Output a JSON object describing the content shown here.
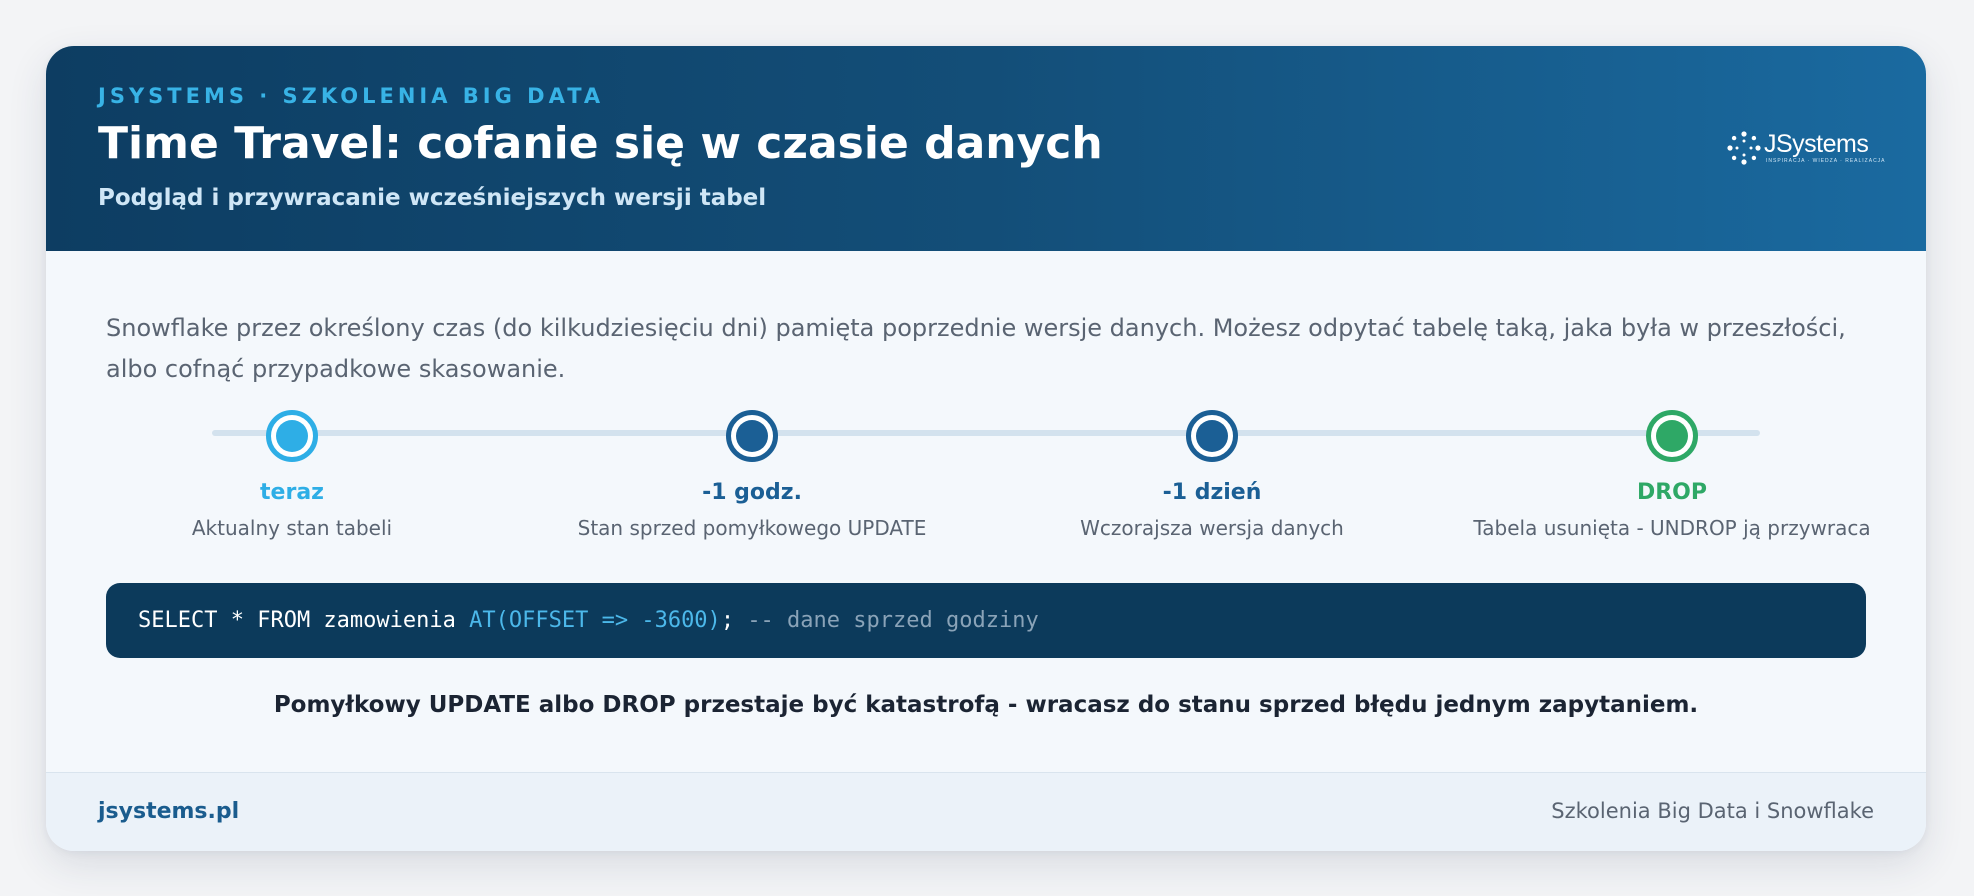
{
  "header": {
    "eyebrow": "JSYSTEMS · SZKOLENIA BIG DATA",
    "title": "Time Travel: cofanie się w czasie danych",
    "subtitle": "Podgląd i przywracanie wcześniejszych wersji tabel",
    "logo": {
      "name": "JSystems",
      "tagline": "INSPIRACJA · WIEDZA · REALIZACJA",
      "icon": "dot-circle-logo-icon"
    }
  },
  "intro": "Snowflake przez określony czas (do kilkudziesięciu dni) pamięta poprzednie wersje danych. Możesz odpytać tabelę taką, jaka była w przeszłości, albo cofnąć przypadkowe skasowanie.",
  "timeline": {
    "points": [
      {
        "label": "teraz",
        "desc": "Aktualny stan tabeli",
        "color": "#2eaee6",
        "ring": "#2eaee6"
      },
      {
        "label": "-1 godz.",
        "desc": "Stan sprzed pomyłkowego UPDATE",
        "color": "#1b5f95",
        "ring": "#1b5f95"
      },
      {
        "label": "-1 dzień",
        "desc": "Wczorajsza wersja danych",
        "color": "#1b5f95",
        "ring": "#1b5f95"
      },
      {
        "label": "DROP",
        "desc": "Tabela usunięta - UNDROP ją przywraca",
        "color": "#2ea866",
        "ring": "#2ea866"
      }
    ]
  },
  "code": {
    "base": "SELECT * FROM zamowienia ",
    "keyword": "AT(OFFSET => -3600)",
    "semicolon": "; ",
    "comment": "-- dane sprzed godziny"
  },
  "tagline": "Pomyłkowy UPDATE albo DROP przestaje być katastrofą - wracasz do stanu sprzed błędu jednym zapytaniem.",
  "footer": {
    "left": "jsystems.pl",
    "right": "Szkolenia Big Data i Snowflake"
  },
  "colors": {
    "header_dark": "#0d3d62",
    "header_light": "#1a6aa0",
    "accent": "#38b3e6",
    "code_bg": "#0c3a5b"
  }
}
